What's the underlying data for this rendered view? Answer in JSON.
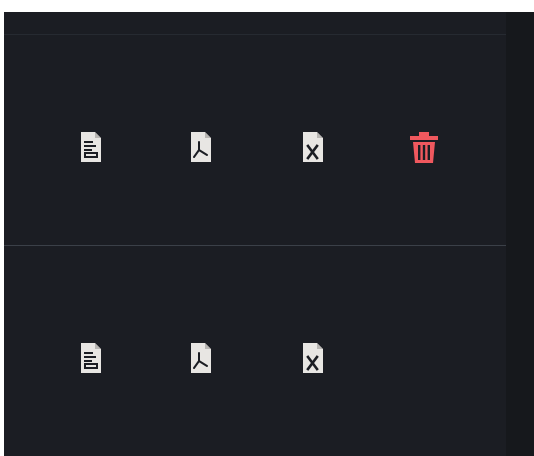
{
  "colors": {
    "panel_background": "#1b1d23",
    "icon_fill": "#e8e6e3",
    "icon_dark": "#1b1d23",
    "delete_accent": "#f0585e",
    "divider": "#3b4048"
  },
  "rows": [
    {
      "actions": [
        {
          "icon": "document-icon",
          "label": ""
        },
        {
          "icon": "pdf-file-icon",
          "label": ""
        },
        {
          "icon": "excel-file-icon",
          "label": "x"
        },
        {
          "icon": "trash-icon",
          "label": ""
        }
      ]
    },
    {
      "actions": [
        {
          "icon": "document-icon",
          "label": ""
        },
        {
          "icon": "pdf-file-icon",
          "label": ""
        },
        {
          "icon": "excel-file-icon",
          "label": "x"
        }
      ]
    }
  ]
}
